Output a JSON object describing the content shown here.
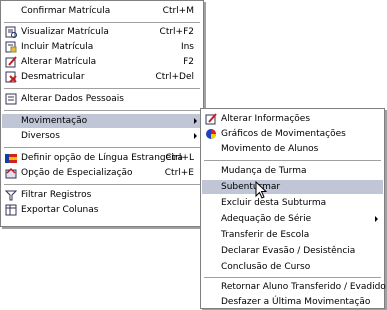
{
  "main_menu": {
    "items": [
      {
        "label": "Confirmar Matrícula",
        "shortcut": "Ctrl+M",
        "icon": "confirm-enrollment-icon"
      },
      {
        "label": "Visualizar Matrícula",
        "shortcut": "Ctrl+F2",
        "icon": "view-enrollment-icon"
      },
      {
        "label": "Incluir Matrícula",
        "shortcut": "Ins",
        "icon": "add-enrollment-icon"
      },
      {
        "label": "Alterar Matrícula",
        "shortcut": "F2",
        "icon": "edit-enrollment-icon"
      },
      {
        "label": "Desmatricular",
        "shortcut": "Ctrl+Del",
        "icon": "unenroll-icon"
      },
      {
        "label": "Alterar Dados Pessoais",
        "shortcut": "",
        "icon": "personal-data-icon"
      },
      {
        "label": "Movimentação",
        "shortcut": "",
        "icon": ""
      },
      {
        "label": "Diversos",
        "shortcut": "",
        "icon": ""
      },
      {
        "label": "Definir opção de Língua Estrangeira",
        "shortcut": "Ctrl+L",
        "icon": "flag-icon"
      },
      {
        "label": "Opção de Especialização",
        "shortcut": "Ctrl+E",
        "icon": "specialization-icon"
      },
      {
        "label": "Filtrar Registros",
        "shortcut": "",
        "icon": "filter-icon"
      },
      {
        "label": "Exportar Colunas",
        "shortcut": "",
        "icon": "export-icon"
      }
    ]
  },
  "sub_menu": {
    "items": [
      {
        "label": "Alterar Informações",
        "icon": "edit-info-icon"
      },
      {
        "label": "Gráficos de Movimentações",
        "icon": "pie-chart-icon"
      },
      {
        "label": "Movimento de Alunos",
        "icon": ""
      },
      {
        "label": "Mudança de Turma",
        "icon": ""
      },
      {
        "label": "Subenturmar",
        "icon": ""
      },
      {
        "label": "Excluir desta Subturma",
        "icon": ""
      },
      {
        "label": "Adequação de Série",
        "icon": ""
      },
      {
        "label": "Transferir de Escola",
        "icon": ""
      },
      {
        "label": "Declarar Evasão / Desistência",
        "icon": ""
      },
      {
        "label": "Conclusão de Curso",
        "icon": ""
      },
      {
        "label": "Retornar Aluno Transferido / Evadido",
        "icon": ""
      },
      {
        "label": "Desfazer a Última Movimentação",
        "icon": ""
      }
    ]
  },
  "colors": {
    "highlight": "#c0c6d6",
    "border": "#808080"
  }
}
